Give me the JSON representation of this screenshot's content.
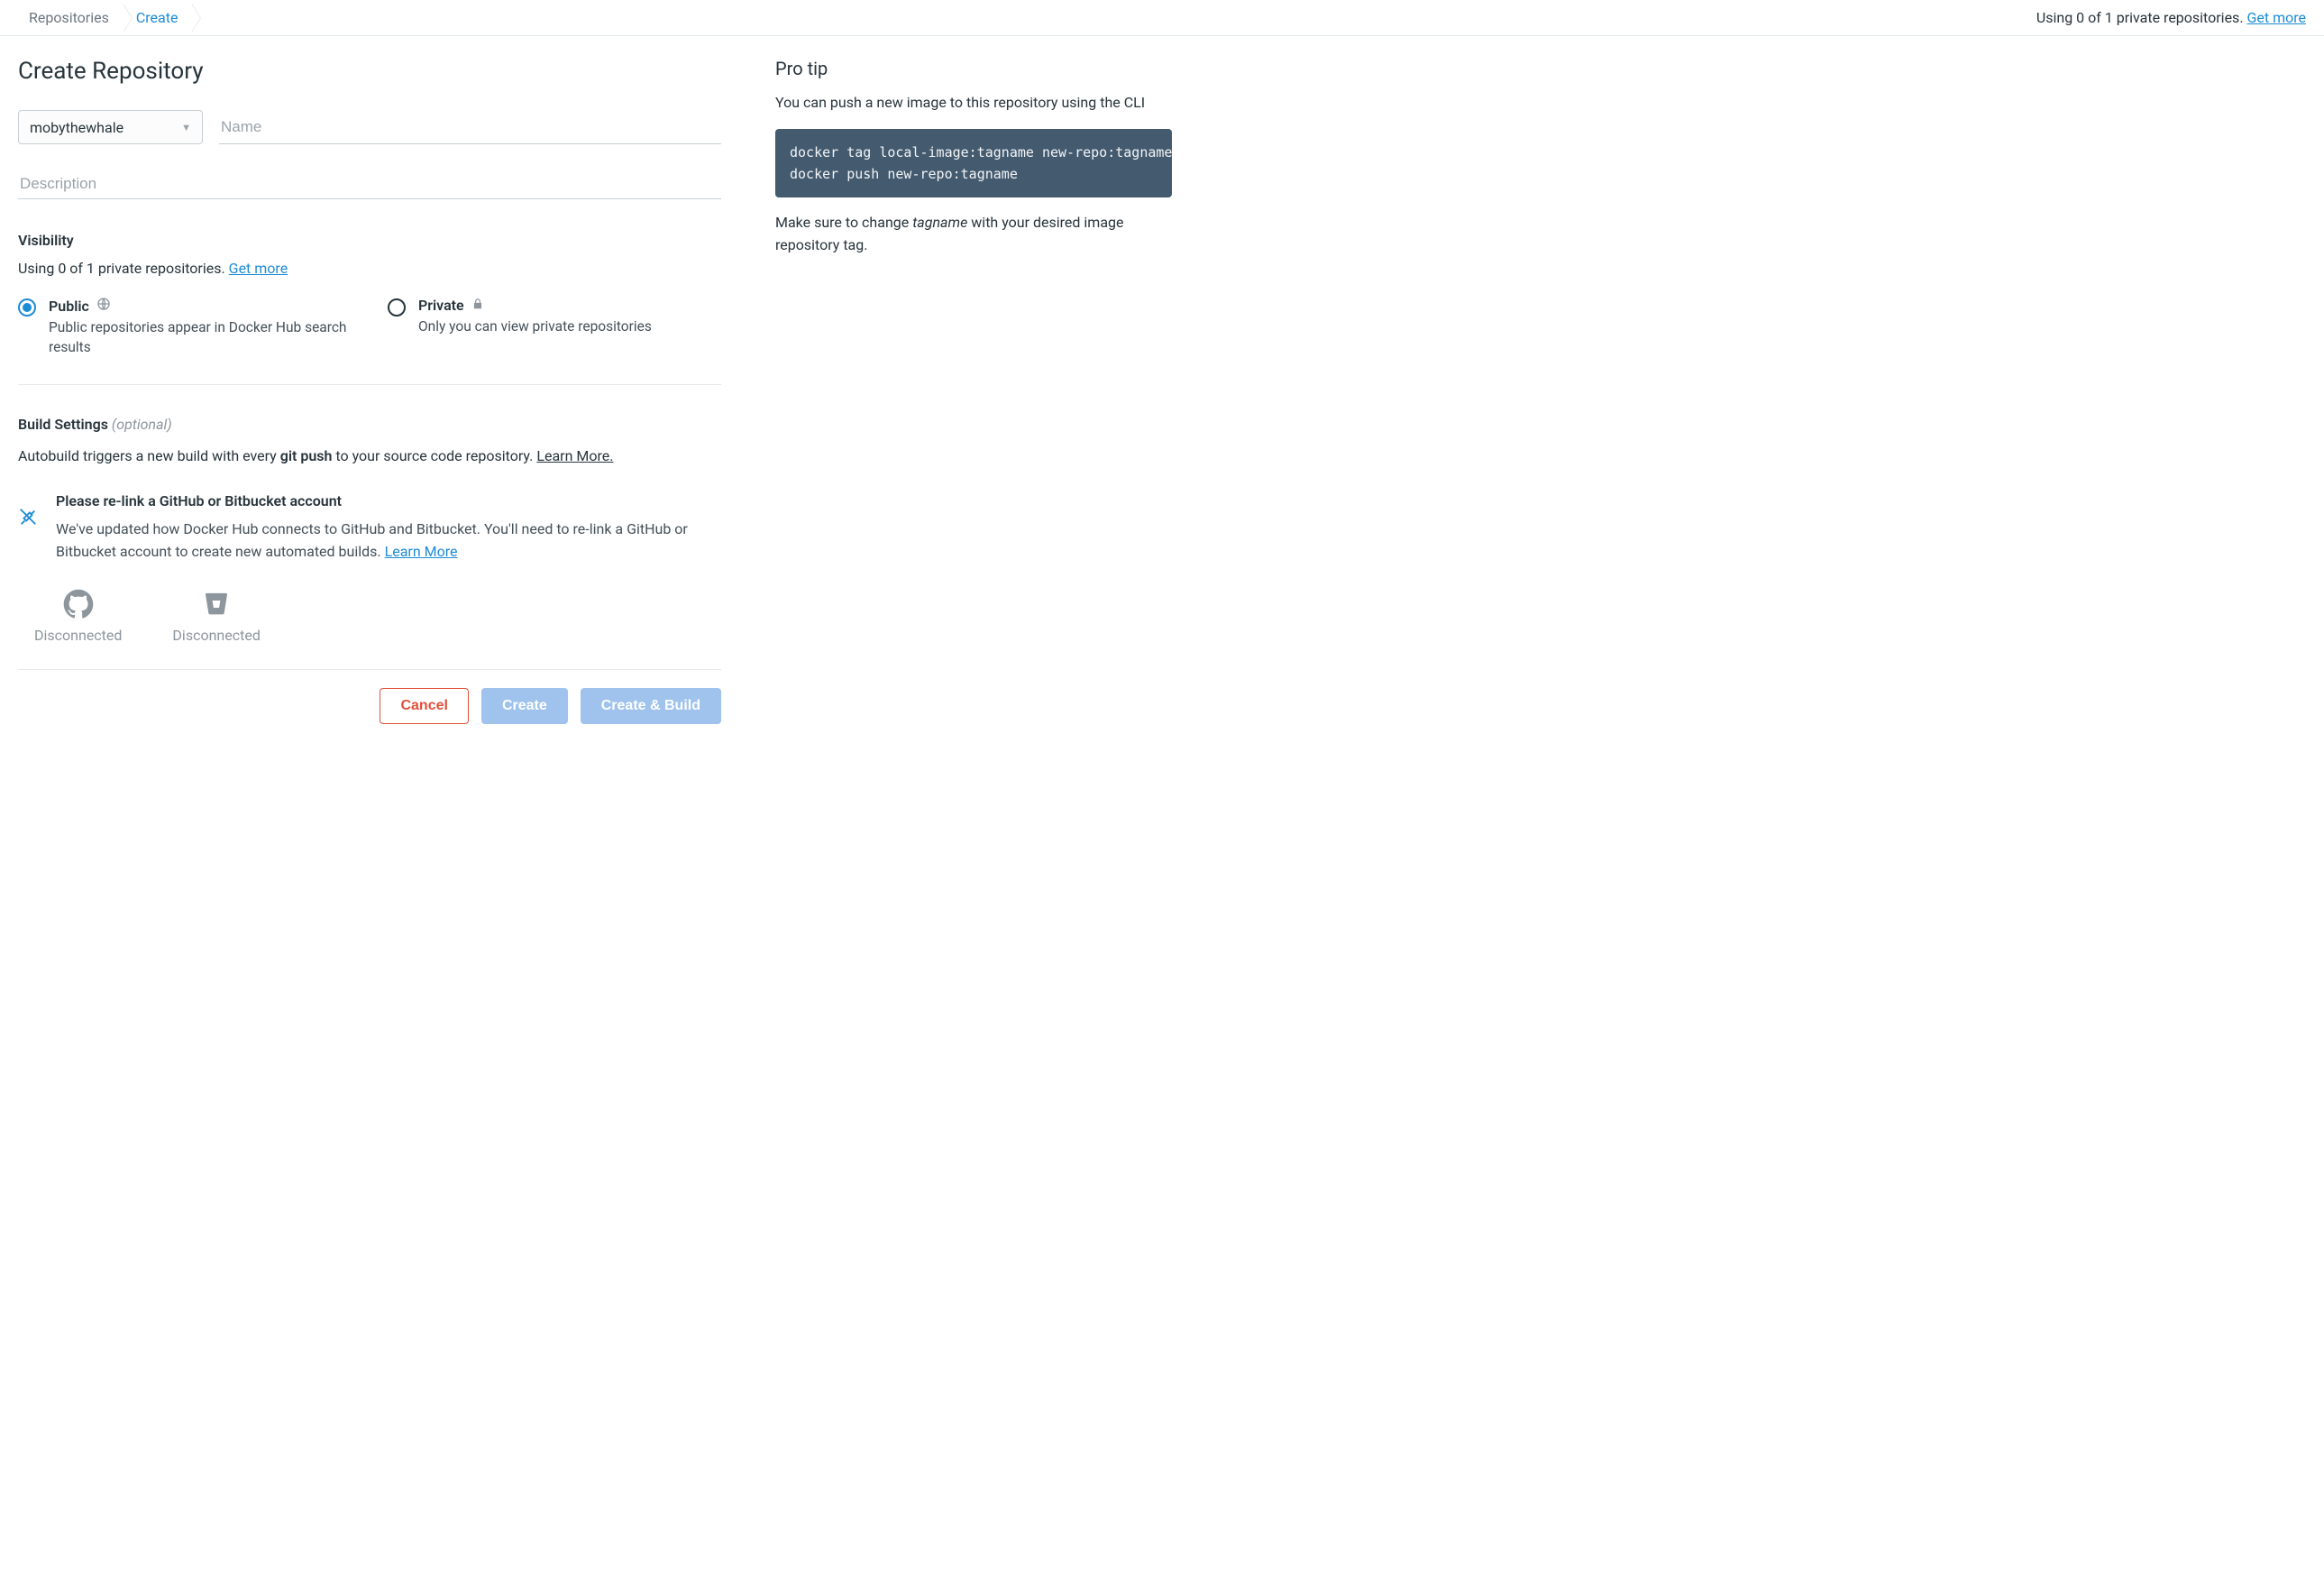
{
  "breadcrumb": {
    "root": "Repositories",
    "current": "Create"
  },
  "topbar": {
    "usage": "Using 0 of 1 private repositories. ",
    "get_more": "Get more"
  },
  "page": {
    "title": "Create Repository"
  },
  "form": {
    "namespace_selected": "mobythewhale",
    "name_placeholder": "Name",
    "description_placeholder": "Description"
  },
  "visibility": {
    "title": "Visibility",
    "usage": "Using 0 of 1 private repositories. ",
    "get_more": "Get more",
    "public": {
      "label": "Public",
      "desc": "Public repositories appear in Docker Hub search results"
    },
    "private": {
      "label": "Private",
      "desc": "Only you can view private repositories"
    }
  },
  "build": {
    "title": "Build Settings ",
    "optional": "(optional)",
    "para_pre": "Autobuild triggers a new build with every ",
    "para_bold": "git push",
    "para_post": " to your source code repository. ",
    "learn_more": "Learn More.",
    "notice_title": "Please re-link a GitHub or Bitbucket account",
    "notice_text_pre": "We've updated how Docker Hub connects to GitHub and Bitbucket. You'll need to re-link a GitHub or Bitbucket account to create new automated builds. ",
    "notice_learn_more": "Learn More",
    "github_status": "Disconnected",
    "bitbucket_status": "Disconnected"
  },
  "actions": {
    "cancel": "Cancel",
    "create": "Create",
    "create_build": "Create & Build"
  },
  "tip": {
    "title": "Pro tip",
    "p1": "You can push a new image to this repository using the CLI",
    "code": "docker tag local-image:tagname new-repo:tagname\ndocker push new-repo:tagname",
    "p2a": "Make sure to change ",
    "p2b": "tagname",
    "p2c": " with your desired image repository tag."
  }
}
